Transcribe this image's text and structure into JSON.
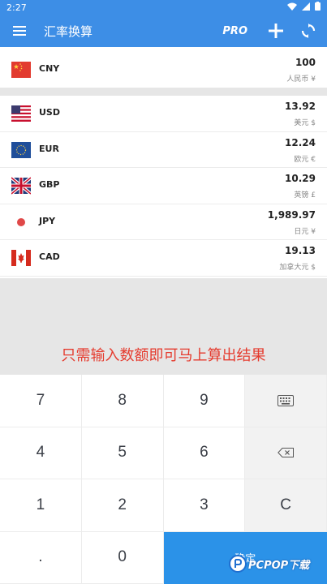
{
  "status_bar": {
    "time": "2:27"
  },
  "app": {
    "title": "汇率换算",
    "pro_label": "PRO"
  },
  "base": {
    "code": "CNY",
    "amount": "100",
    "name": "人民币 ¥"
  },
  "currencies": [
    {
      "code": "USD",
      "amount": "13.92",
      "name": "美元 $"
    },
    {
      "code": "EUR",
      "amount": "12.24",
      "name": "欧元 €"
    },
    {
      "code": "GBP",
      "amount": "10.29",
      "name": "英镑 £"
    },
    {
      "code": "JPY",
      "amount": "1,989.97",
      "name": "日元 ¥"
    },
    {
      "code": "CAD",
      "amount": "19.13",
      "name": "加拿大元 $"
    }
  ],
  "promo_text": "只需输入数额即可马上算出结果",
  "keypad": {
    "k7": "7",
    "k8": "8",
    "k9": "9",
    "k4": "4",
    "k5": "5",
    "k6": "6",
    "k1": "1",
    "k2": "2",
    "k3": "3",
    "kc": "C",
    "kdot": ".",
    "k0": "0",
    "ok": "确定"
  },
  "watermark": {
    "brand": "PCPOP下载"
  },
  "colors": {
    "primary": "#3d8ee6",
    "accent_button": "#2b92e8",
    "promo_red": "#e53b2e"
  }
}
